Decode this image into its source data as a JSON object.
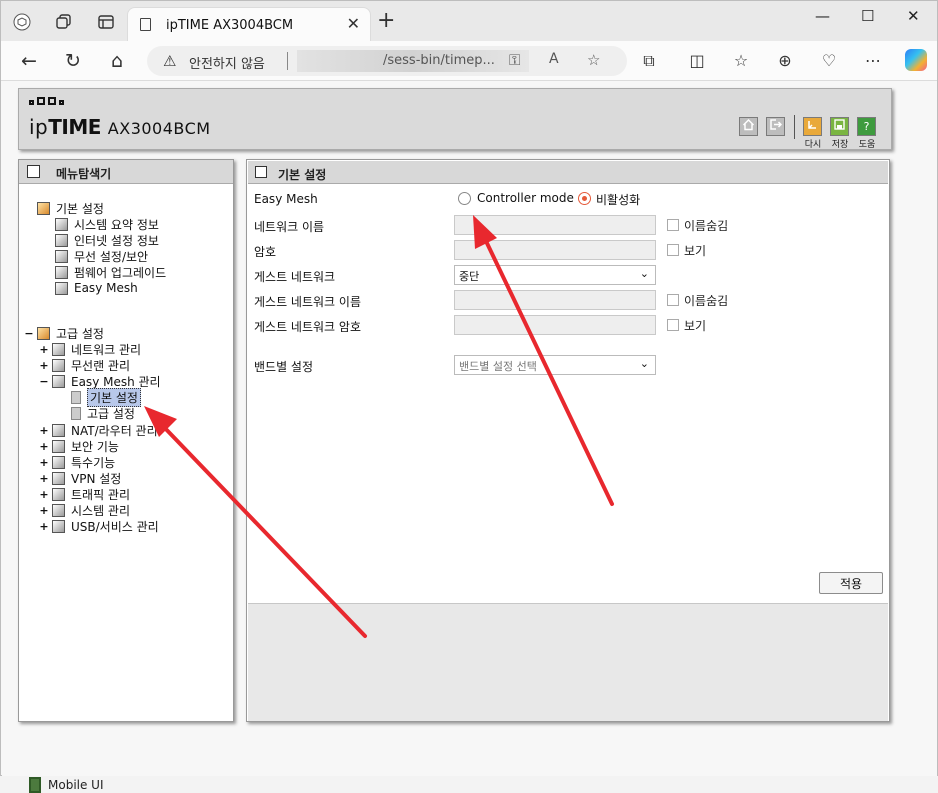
{
  "browser": {
    "tab_title": "ipTIME AX3004BCM",
    "tab_close": "✕",
    "new_tab": "+",
    "window_minimize": "—",
    "window_maximize": "☐",
    "window_close": "✕",
    "address_warning": "안전하지 않음",
    "address_url": "/sess-bin/timep..."
  },
  "header": {
    "logo_ip": "ip",
    "logo_time": "TIME",
    "logo_model": "AX3004BCM",
    "btn_home_label": "",
    "btn_logout_label": "",
    "btn_refresh_label": "다시",
    "btn_save_label": "저장",
    "btn_help_label": "도움",
    "btn_help_glyph": "?"
  },
  "left": {
    "title": "메뉴탐색기",
    "tree": {
      "basic_group": "기본 설정",
      "basic_items": [
        "시스템 요약 정보",
        "인터넷 설정 정보",
        "무선 설정/보안",
        "펌웨어 업그레이드",
        "Easy Mesh"
      ],
      "advanced_group": "고급 설정",
      "advanced_items": [
        "네트워크 관리",
        "무선랜 관리",
        "Easy Mesh 관리",
        "NAT/라우터 관리",
        "보안 기능",
        "특수기능",
        "VPN 설정",
        "트래픽 관리",
        "시스템 관리",
        "USB/서비스 관리"
      ],
      "mesh_children": [
        "기본 설정",
        "고급 설정"
      ]
    },
    "mobile_ui": "Mobile UI"
  },
  "right": {
    "title": "기본 설정",
    "easy_mesh_label": "Easy Mesh",
    "radio_controller": "Controller mode",
    "radio_disable": "비활성화",
    "selected_mode": "비활성화",
    "network_name_label": "네트워크 이름",
    "hide_name_label": "이름숨김",
    "password_label": "암호",
    "show_label": "보기",
    "guest_network_label": "게스트 네트워크",
    "guest_network_value": "중단",
    "guest_name_label": "게스트 네트워크 이름",
    "guest_hide_label": "이름숨김",
    "guest_password_label": "게스트 네트워크 암호",
    "guest_show_label": "보기",
    "band_label": "밴드별 설정",
    "band_placeholder": "밴드별 설정 선택",
    "apply_label": "적용"
  },
  "colors": {
    "annotation_arrow": "#e8282e",
    "radio_accent": "#e55a3a"
  }
}
